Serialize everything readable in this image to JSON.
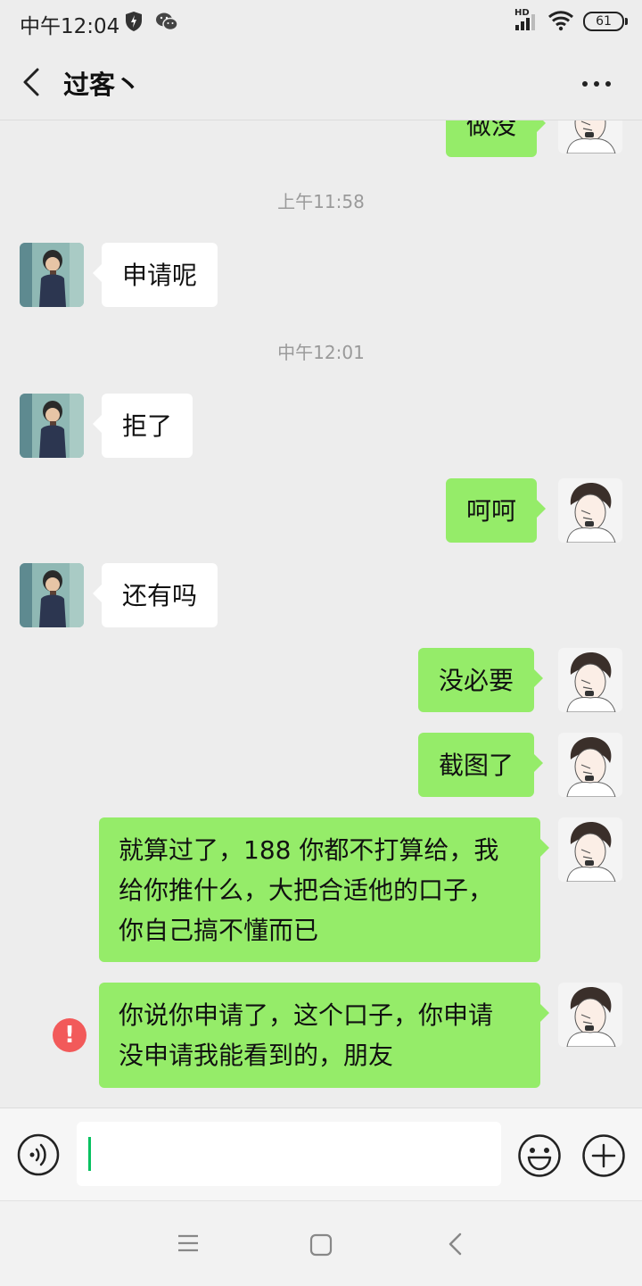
{
  "status_bar": {
    "time": "中午12:04",
    "network": "HD",
    "battery": "61"
  },
  "header": {
    "title": "过客丶"
  },
  "messages": [
    {
      "from": "me",
      "text": "做没"
    },
    {
      "type": "timestamp",
      "text": "上午11:58"
    },
    {
      "from": "contact",
      "text": "申请呢"
    },
    {
      "type": "timestamp",
      "text": "中午12:01"
    },
    {
      "from": "contact",
      "text": "拒了"
    },
    {
      "from": "me",
      "text": "呵呵"
    },
    {
      "from": "contact",
      "text": "还有吗"
    },
    {
      "from": "me",
      "text": "没必要"
    },
    {
      "from": "me",
      "text": "截图了"
    },
    {
      "from": "me",
      "lines": [
        "就算过了，188 你都不打算给，我",
        "给你推什么，大把合适他的口子，",
        "你自己搞不懂而已"
      ]
    },
    {
      "from": "me",
      "lines": [
        "你说你申请了，这个口子，你申请",
        "没申请我能看到的，朋友"
      ],
      "status": "failed",
      "status_icon": "!"
    }
  ],
  "colors": {
    "outgoing_bubble": "#95ec69",
    "incoming_bubble": "#ffffff",
    "background": "#ededed",
    "error": "#f25a5a",
    "caret": "#07c160"
  }
}
